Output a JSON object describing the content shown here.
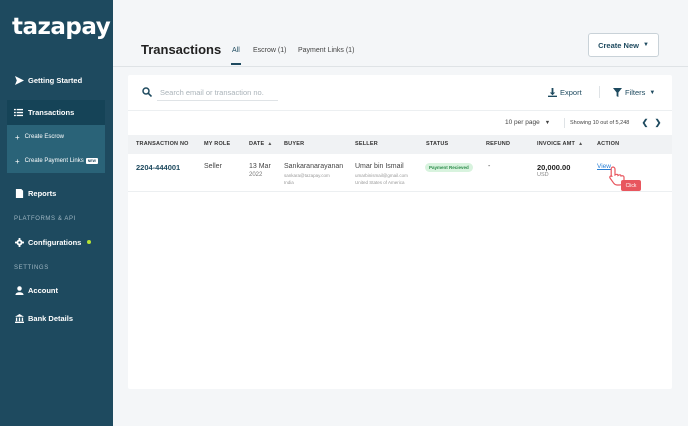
{
  "brand": {
    "logo_text": "tazapay"
  },
  "sidebar": {
    "getting_started": "Getting Started",
    "transactions": "Transactions",
    "create_escrow": "Create Escrow",
    "create_payment_links": "Create Payment Links",
    "new_badge": "NEW",
    "reports": "Reports",
    "section_platforms": "PLATFORMS & API",
    "configurations": "Configurations",
    "section_settings": "SETTINGS",
    "account": "Account",
    "bank_details": "Bank Details"
  },
  "header": {
    "title": "Transactions",
    "tabs": [
      {
        "label": "All"
      },
      {
        "label": "Escrow (1)"
      },
      {
        "label": "Payment Links (1)"
      }
    ],
    "create_new": "Create New"
  },
  "toolbar": {
    "search_placeholder": "Search email or transaction no.",
    "export": "Export",
    "filters": "Filters"
  },
  "pagination": {
    "per_page": "10 per page",
    "showing": "Showing 10 out of 5,248"
  },
  "table": {
    "columns": [
      "TRANSACTION NO",
      "MY ROLE",
      "DATE",
      "BUYER",
      "SELLER",
      "STATUS",
      "REFUND",
      "INVOICE AMT",
      "ACTION"
    ],
    "rows": [
      {
        "txn_no": "2204-444001",
        "role": "Seller",
        "date_day": "13 Mar",
        "date_year": "2022",
        "buyer_name": "Sankaranarayanan",
        "buyer_email": "sankara@tazapay.com",
        "buyer_country": "India",
        "seller_name": "Umar bin Ismail",
        "seller_email": "umarbinismail@gmail.com",
        "seller_country": "United States of America",
        "status": "Payment Recieved",
        "refund": "-",
        "amount": "20,000.00",
        "currency": "USD",
        "action": "View"
      }
    ]
  },
  "overlay": {
    "click_label": "Click"
  },
  "colors": {
    "sidebar": "#1e4a5f",
    "accent": "#1e4a5f",
    "status_green": "#2a8a48"
  }
}
